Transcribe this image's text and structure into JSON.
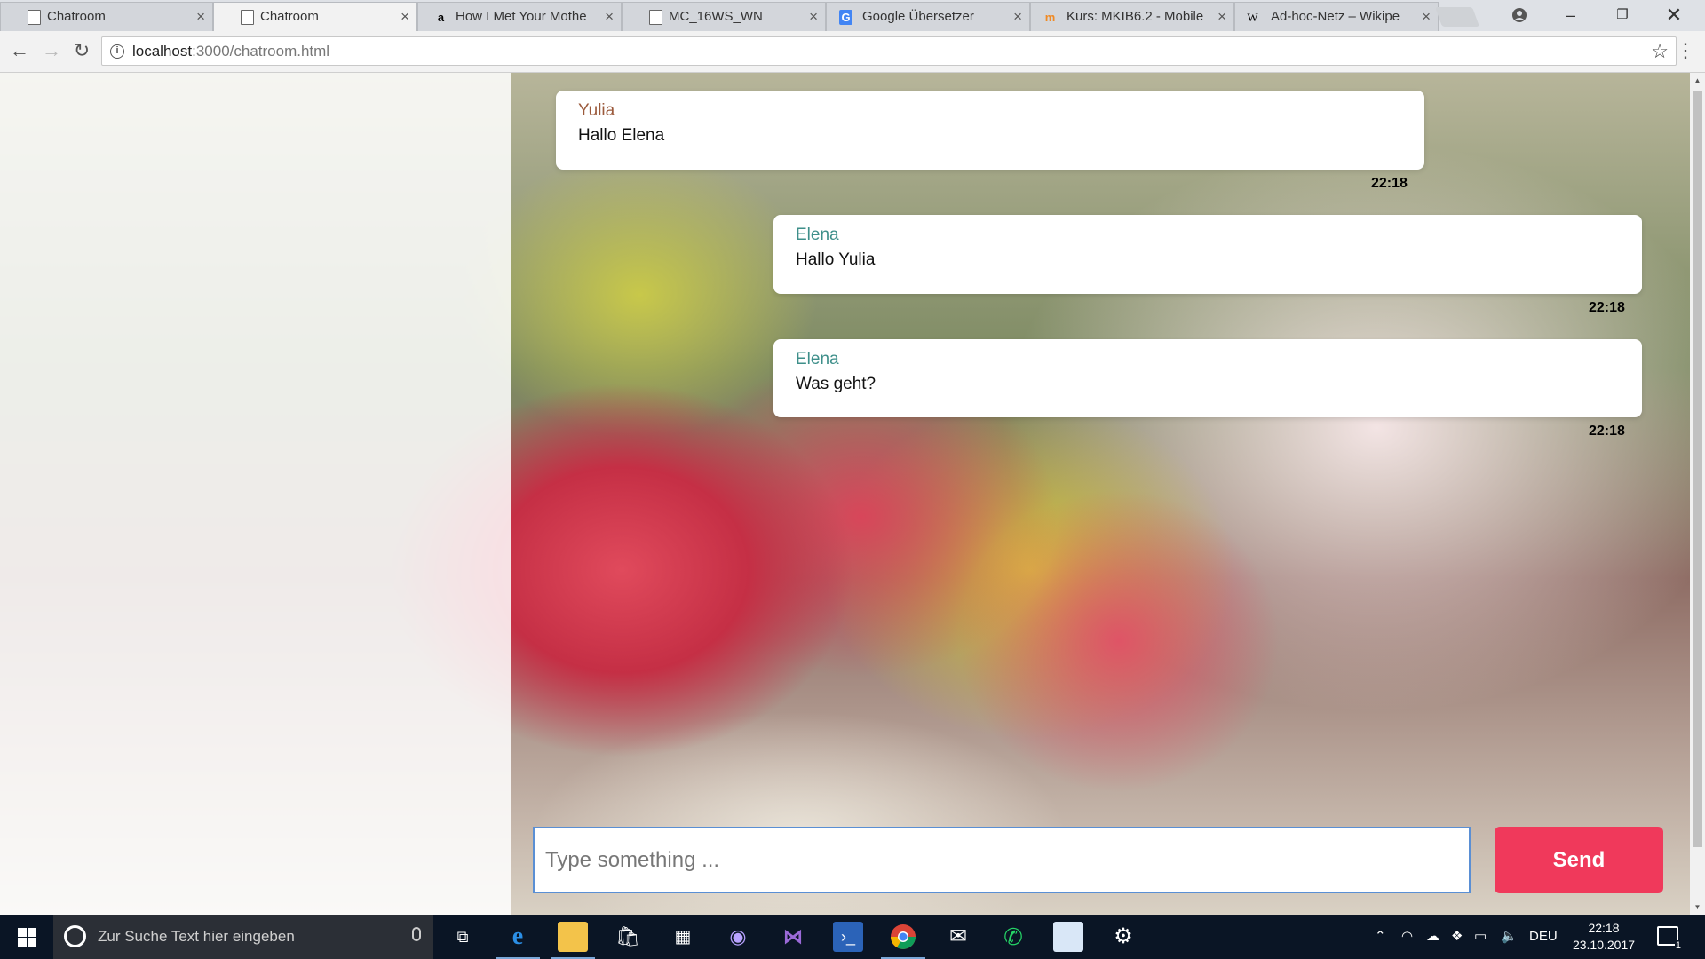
{
  "browser": {
    "tabs": [
      {
        "title": "Chatroom",
        "icon": "page-icon",
        "active": false
      },
      {
        "title": "Chatroom",
        "icon": "page-icon",
        "active": true
      },
      {
        "title": "How I Met Your Mothe",
        "icon": "amazon-icon",
        "active": false
      },
      {
        "title": "MC_16WS_WN",
        "icon": "page-icon",
        "active": false
      },
      {
        "title": "Google Übersetzer",
        "icon": "google-translate-icon",
        "active": false
      },
      {
        "title": "Kurs: MKIB6.2 - Mobile",
        "icon": "moodle-icon",
        "active": false
      },
      {
        "title": "Ad-hoc-Netz – Wikipe",
        "icon": "wikipedia-icon",
        "active": false
      }
    ],
    "address": {
      "host": "localhost",
      "path": ":3000/chatroom.html"
    }
  },
  "chat": {
    "messages": [
      {
        "author": "Yulia",
        "text": "Hallo Elena",
        "time": "22:18"
      },
      {
        "author": "Elena",
        "text": "Hallo Yulia",
        "time": "22:18"
      },
      {
        "author": "Elena",
        "text": "Was geht?",
        "time": "22:18"
      }
    ],
    "input_placeholder": "Type something ...",
    "send_label": "Send"
  },
  "taskbar": {
    "search_placeholder": "Zur Suche Text hier eingeben",
    "language": "DEU",
    "time": "22:18",
    "date": "23.10.2017",
    "notification_count": "1"
  },
  "colors": {
    "send_button": "#f0395b",
    "yulia_name": "#9b5a3c",
    "elena_name": "#3e8f8a",
    "input_border": "#5a8fd4"
  }
}
